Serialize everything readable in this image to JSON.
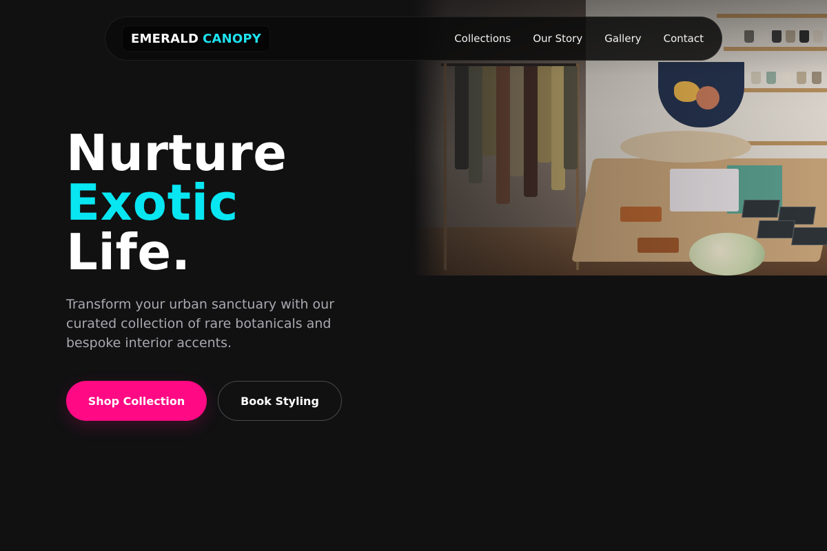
{
  "brand": {
    "word1": "EMERALD",
    "word2": "CANOPY"
  },
  "nav": {
    "items": [
      {
        "label": "Collections"
      },
      {
        "label": "Our Story"
      },
      {
        "label": "Gallery"
      },
      {
        "label": "Contact"
      }
    ]
  },
  "hero": {
    "headline_line1": "Nurture",
    "headline_line2": "Exotic",
    "headline_line3": "Life.",
    "subtitle": "Transform your urban sanctuary with our curated collection of rare botanicals and bespoke interior accents.",
    "primary_cta": "Shop Collection",
    "secondary_cta": "Book Styling",
    "image_icon": "boutique-store-photo"
  },
  "colors": {
    "background": "#111112",
    "accent_cyan": "#08e6f2",
    "accent_pink": "#ff0a84",
    "text_muted": "#a9a9b0"
  }
}
